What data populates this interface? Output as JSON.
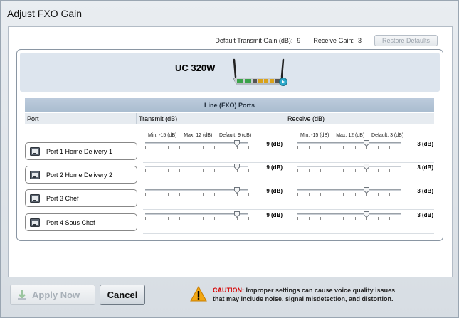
{
  "window": {
    "title": "Adjust FXO Gain"
  },
  "gain_bar": {
    "transmit_label": "Default Transmit Gain (dB):",
    "transmit_value": "9",
    "receive_label": "Receive Gain:",
    "receive_value": "3",
    "restore_label": "Restore Defaults"
  },
  "device": {
    "name": "UC 320W"
  },
  "table": {
    "title": "Line (FXO) Ports",
    "headers": {
      "port": "Port",
      "transmit": "Transmit (dB)",
      "receive": "Receive (dB)"
    }
  },
  "transmit_limits": {
    "min": "Min: -15 (dB)",
    "max": "Max: 12 (dB)",
    "default": "Default: 9 (dB)"
  },
  "receive_limits": {
    "min": "Min: -15 (dB)",
    "max": "Max: 12 (dB)",
    "default": "Default: 3 (dB)"
  },
  "slider_scale": {
    "min": -15,
    "max": 12
  },
  "ports": [
    {
      "label": "Port 1 Home Delivery 1",
      "transmit": 9,
      "transmit_text": "9 (dB)",
      "receive": 3,
      "receive_text": "3 (dB)"
    },
    {
      "label": "Port 2 Home Delivery 2",
      "transmit": 9,
      "transmit_text": "9 (dB)",
      "receive": 3,
      "receive_text": "3 (dB)"
    },
    {
      "label": "Port 3 Chef",
      "transmit": 9,
      "transmit_text": "9 (dB)",
      "receive": 3,
      "receive_text": "3 (dB)"
    },
    {
      "label": "Port 4 Sous Chef",
      "transmit": 9,
      "transmit_text": "9 (dB)",
      "receive": 3,
      "receive_text": "3 (dB)"
    }
  ],
  "buttons": {
    "apply": "Apply Now",
    "cancel": "Cancel"
  },
  "caution": {
    "label": "CAUTION:",
    "line1": "Improper settings can cause voice quality issues",
    "line2": "that may include noise, signal misdetection, and distortion."
  },
  "icons": {
    "port": "phone-jack-icon",
    "apply": "apply-arrow-icon",
    "caution": "warning-triangle-icon"
  },
  "colors": {
    "caution_text": "#d60000",
    "table_title_bg": "#bccbdc"
  }
}
